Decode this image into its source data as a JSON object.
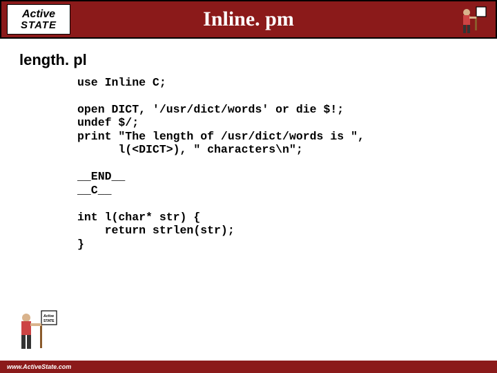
{
  "header": {
    "logo_line1": "Active",
    "logo_line2": "STATE",
    "title": "Inline. pm"
  },
  "subtitle": "length. pl",
  "code": {
    "l1": "use Inline C;",
    "l2": "",
    "l3": "open DICT, '/usr/dict/words' or die $!;",
    "l4": "undef $/;",
    "l5": "print \"The length of /usr/dict/words is \",",
    "l6": "      l(<DICT>), \" characters\\n\";",
    "l7": "",
    "l8": "__END__",
    "l9": "__C__",
    "l10": "",
    "l11": "int l(char* str) {",
    "l12": "    return strlen(str);",
    "l13": "}"
  },
  "footer": {
    "url": "www.ActiveState.com"
  }
}
